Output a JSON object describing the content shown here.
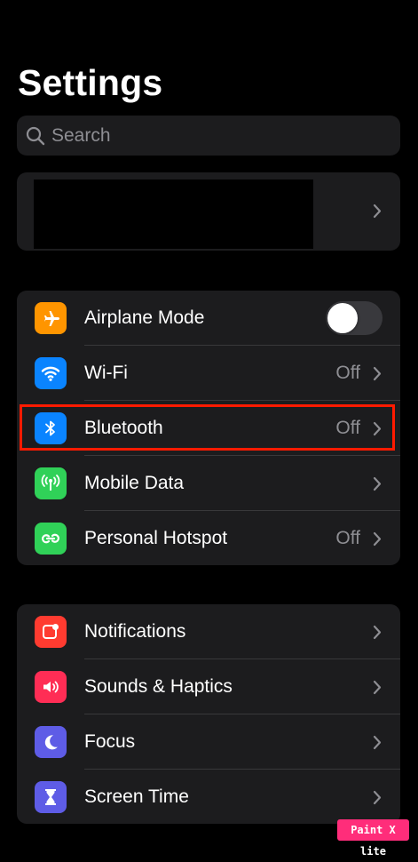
{
  "header": {
    "title": "Settings"
  },
  "search": {
    "placeholder": "Search"
  },
  "group1": {
    "rows": [
      {
        "label": "Airplane Mode",
        "toggle_on": false,
        "icon": "airplane-icon",
        "color": "#ff9500"
      },
      {
        "label": "Wi-Fi",
        "value": "Off",
        "icon": "wifi-icon",
        "color": "#0a84ff"
      },
      {
        "label": "Bluetooth",
        "value": "Off",
        "icon": "bluetooth-icon",
        "color": "#0a84ff"
      },
      {
        "label": "Mobile Data",
        "value": "",
        "icon": "antenna-icon",
        "color": "#30d158"
      },
      {
        "label": "Personal Hotspot",
        "value": "Off",
        "icon": "hotspot-icon",
        "color": "#30d158"
      }
    ]
  },
  "group2": {
    "rows": [
      {
        "label": "Notifications",
        "icon": "bell-icon",
        "color": "#ff3b30"
      },
      {
        "label": "Sounds & Haptics",
        "icon": "speaker-icon",
        "color": "#ff2d55"
      },
      {
        "label": "Focus",
        "icon": "moon-icon",
        "color": "#5e5ce6"
      },
      {
        "label": "Screen Time",
        "icon": "hourglass-icon",
        "color": "#5e5ce6"
      }
    ]
  },
  "annotation": {
    "highlight_color": "#ff1a00"
  },
  "watermark": {
    "text": "Paint X lite"
  }
}
